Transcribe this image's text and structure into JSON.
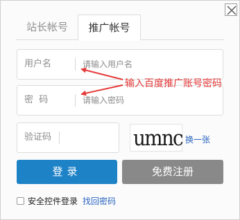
{
  "tabs": [
    {
      "label": "站长帐号",
      "active": false
    },
    {
      "label": "推广帐号",
      "active": true
    }
  ],
  "form": {
    "username": {
      "label": "用户名",
      "placeholder": "请输入用户名",
      "value": ""
    },
    "password": {
      "label": "密  码",
      "placeholder": "请输入密码",
      "value": ""
    },
    "captcha": {
      "label": "验证码",
      "value": "",
      "image_text": "umnc",
      "refresh_label": "换一张"
    }
  },
  "buttons": {
    "login_label": "登录",
    "register_label": "免费注册"
  },
  "footer": {
    "remember_label": "安全控件登录",
    "forgot_label": "找回密码"
  },
  "annotation": {
    "text": "输入百度推广账号密码",
    "color": "#e53a3a"
  },
  "colors": {
    "primary": "#1e82c7",
    "secondary": "#898989",
    "link": "#2a64c0"
  },
  "icons": {
    "close": "close-icon"
  }
}
